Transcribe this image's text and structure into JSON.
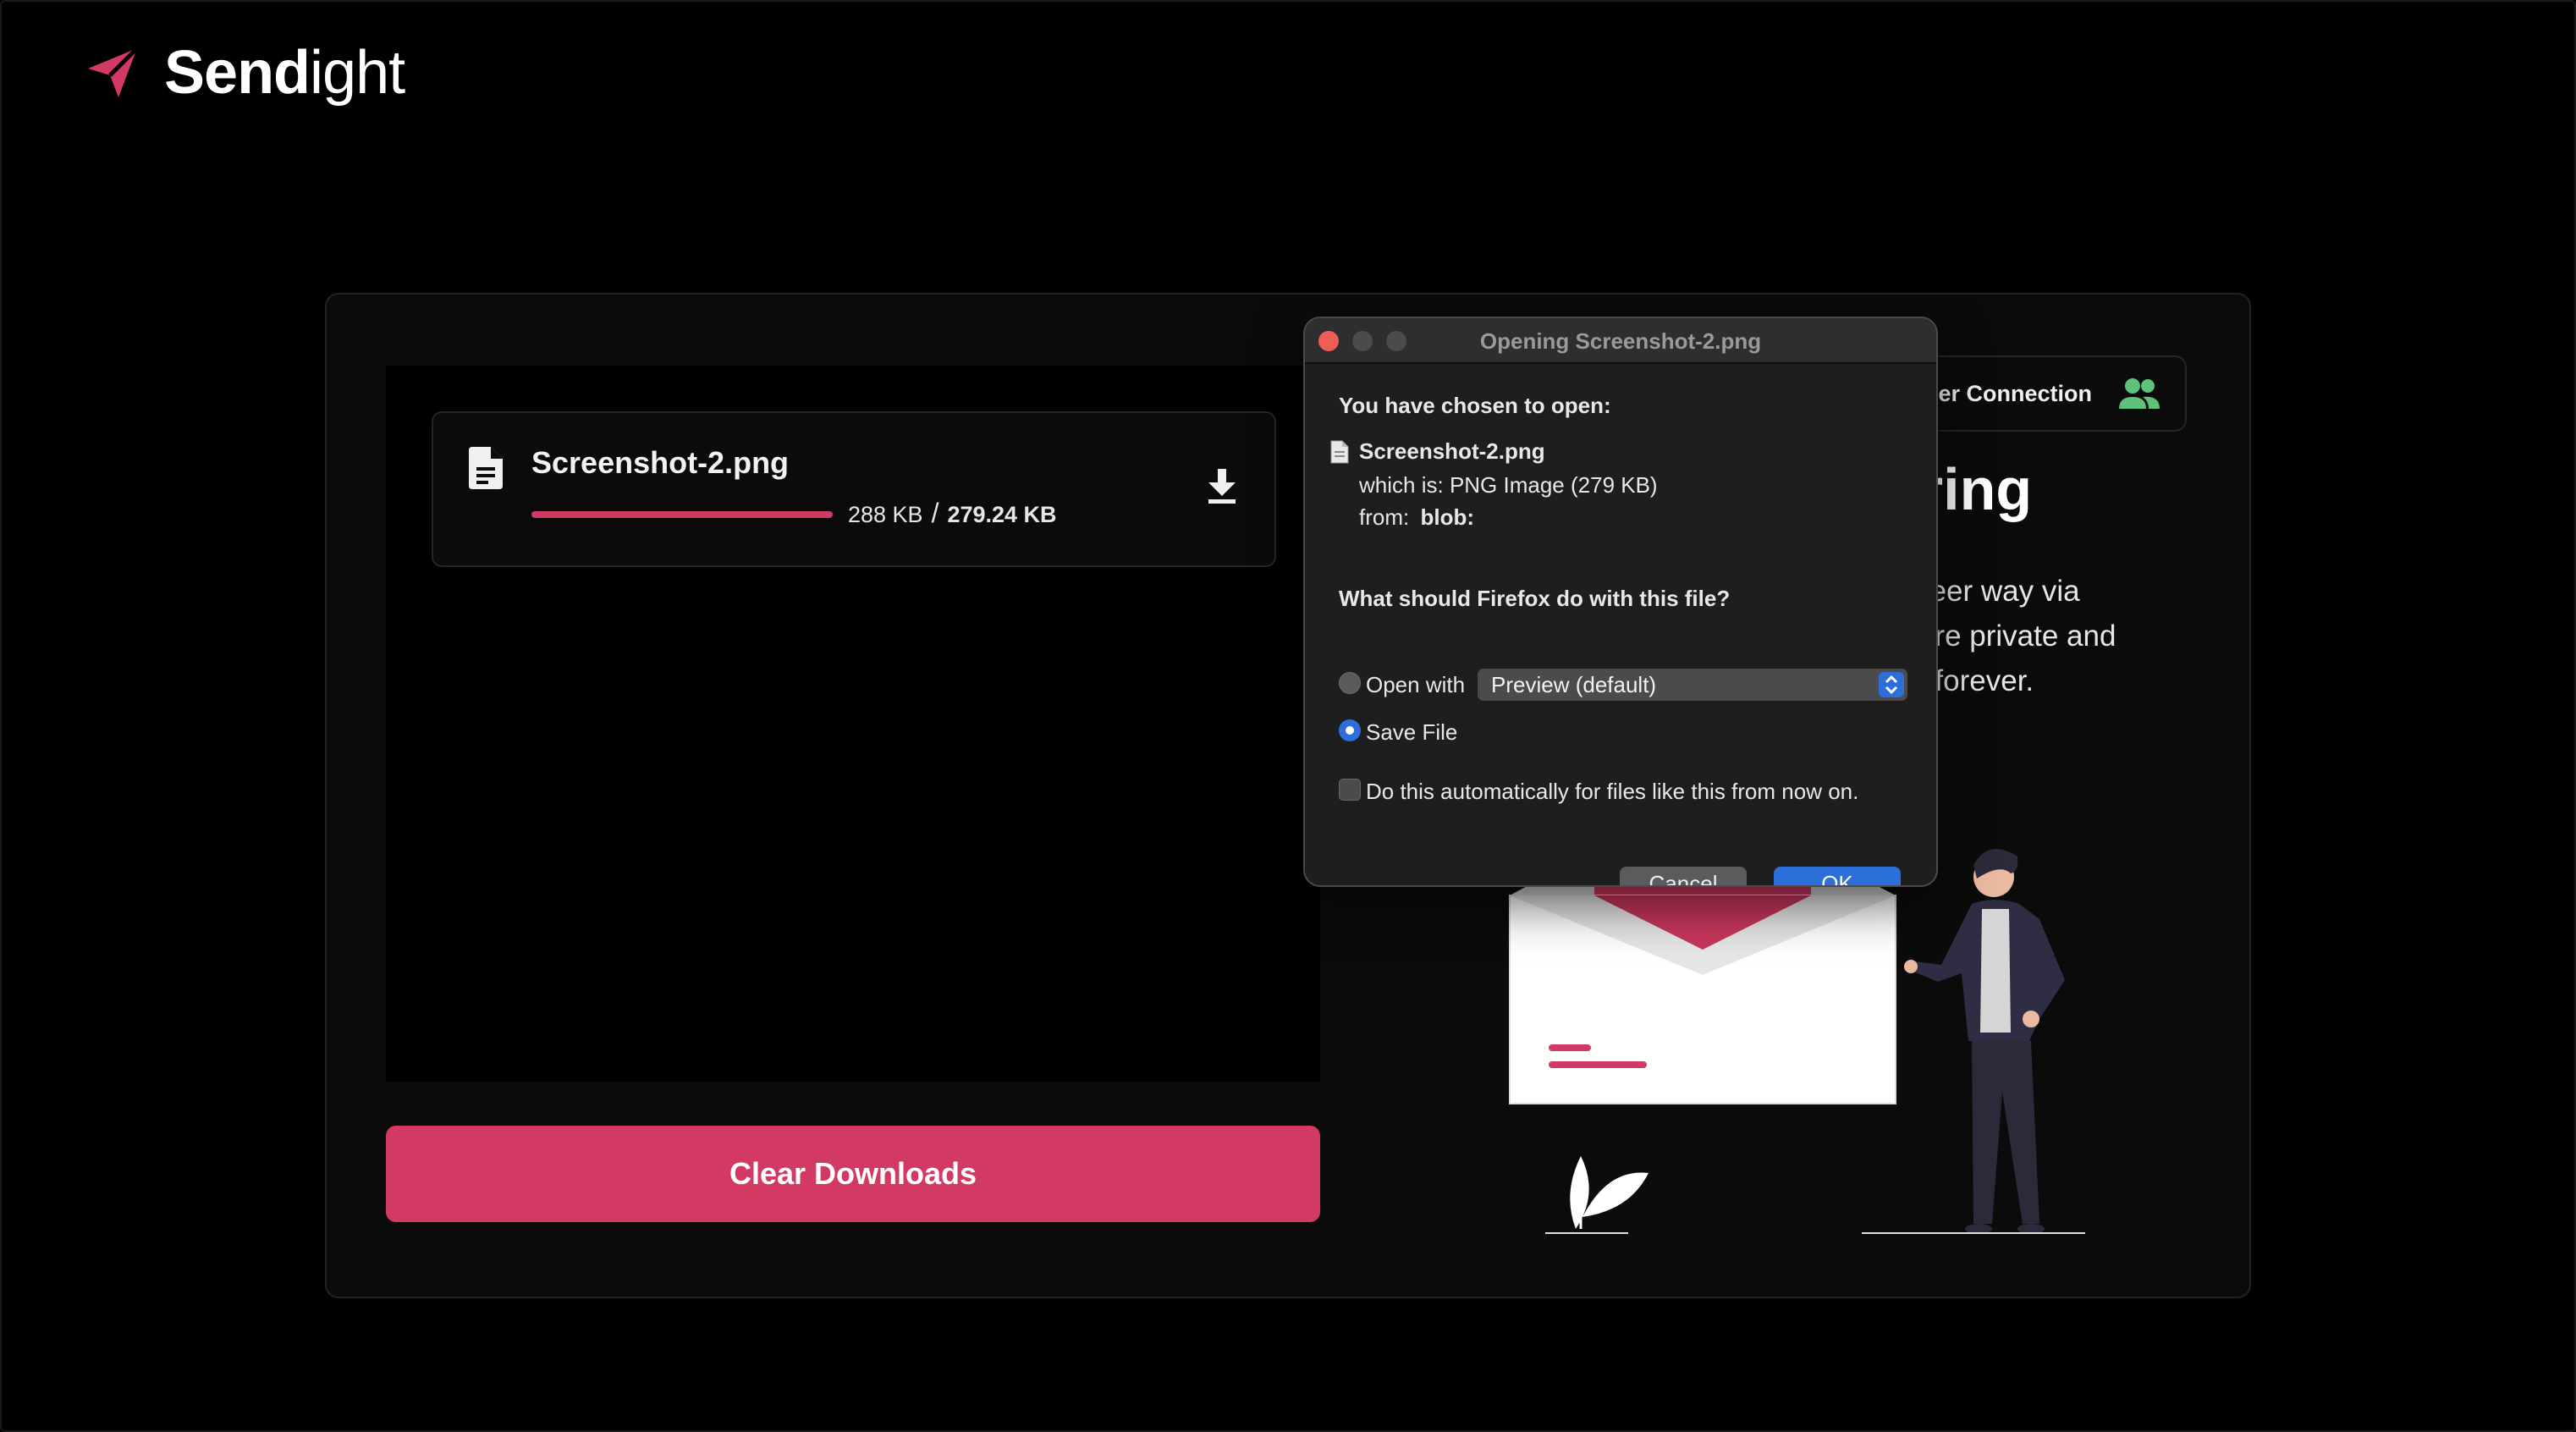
{
  "app": {
    "brand_bold": "Send",
    "brand_light": "ight",
    "accent_color": "#d33a63"
  },
  "download": {
    "file_name": "Screenshot-2.png",
    "received": "288 KB",
    "separator": "/",
    "total": "279.24 KB",
    "progress_fraction": 1.0,
    "file_icon": "file-text-icon",
    "download_icon": "download-icon"
  },
  "actions": {
    "clear_label": "Clear Downloads"
  },
  "right_panel": {
    "badge_text": "er Connection",
    "badge_icon": "people-icon",
    "heading_partial": "aring",
    "desc_lines": [
      "o-peer way via",
      "share private and",
      "ine forever."
    ]
  },
  "dialog": {
    "title": "Opening Screenshot-2.png",
    "chosen_label": "You have chosen to open:",
    "file_name": "Screenshot-2.png",
    "which_is_label": "which is:",
    "which_is_value": "PNG Image (279 KB)",
    "from_label": "from:",
    "from_value": "blob:",
    "question": "What should Firefox do with this file?",
    "open_with_label": "Open with",
    "open_with_value": "Preview (default)",
    "save_file_label": "Save File",
    "selected_option": "Save File",
    "auto_label": "Do this automatically for files like this from now on.",
    "auto_checked": false,
    "cancel_label": "Cancel",
    "ok_label": "OK"
  }
}
